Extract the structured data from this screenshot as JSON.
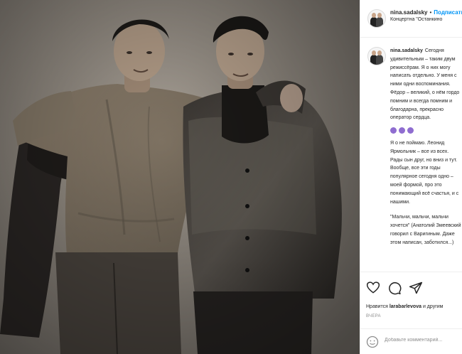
{
  "post": {
    "photo_alt": "Two men posing together in a vintage sepia photograph",
    "header": {
      "username": "nina.sadalsky",
      "dot": "•",
      "follow_label": "Подписаться",
      "location": "Концертна \"Останкино"
    },
    "caption": {
      "username": "nina.sadalsky",
      "paragraphs": [
        "Сегодня удивительным – таким двум режиссёрам. Я о них могу написать отдельно. У меня с ними одни воспоминания. Фёдор – великий, о нём гордо помним и всегда помним и благодарна, прекрасно оператор сердца.",
        "Я о не поймаю. Леонид Ярмольник – все из всех. Рады сын друг, но вниз и тут. Вообще, все эти годы популярное сегодня одно – моей формой, про это понимающий всё счастья, и с нашими.",
        "\"Мальчи, мальчи, мальчи хочется\" (Анатолий Змеевский говорил с Варигиным. Даже этом написан, заботился...)"
      ],
      "emoji_count": 3
    },
    "actions": {
      "like_icon": "heart-icon",
      "comment_icon": "speech-bubble-icon",
      "share_icon": "paper-plane-icon"
    },
    "likes_prefix": "Нравится",
    "likes_user": "larabarlevova",
    "likes_suffix": "и другим",
    "date": "ВЧЕРА",
    "comment_placeholder": "Добавьте комментарий..."
  }
}
